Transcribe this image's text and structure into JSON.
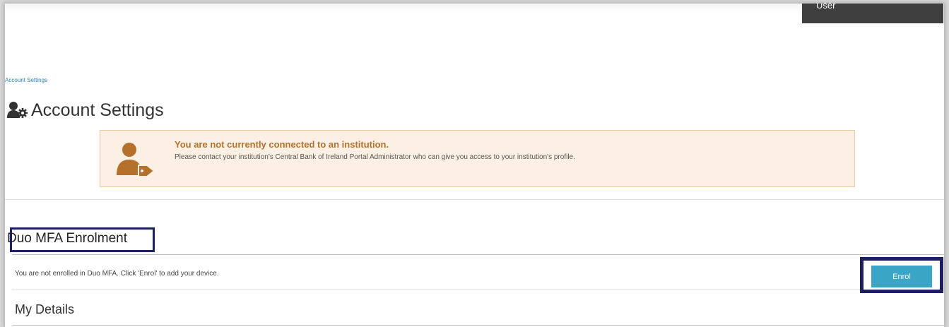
{
  "header": {
    "user_menu_label": "User"
  },
  "breadcrumb": {
    "current": "Account Settings"
  },
  "page": {
    "title": "Account Settings",
    "title_icon": "user-settings-icon"
  },
  "alert": {
    "title": "You are not currently connected to an institution.",
    "message": "Please contact your institution's Central Bank of Ireland Portal Administrator who can give you access to your institution's profile.",
    "icon": "user-tag-icon",
    "accent_color": "#b5712b",
    "background_color": "#fbf0e3"
  },
  "duo_section": {
    "title": "Duo MFA Enrolment",
    "status": "You are not enrolled in Duo MFA. Click 'Enrol' to add your device.",
    "enrol_button_label": "Enrol",
    "button_color": "#3aa5c5",
    "highlight_color": "#1c2060"
  },
  "details_section": {
    "title": "My Details"
  }
}
